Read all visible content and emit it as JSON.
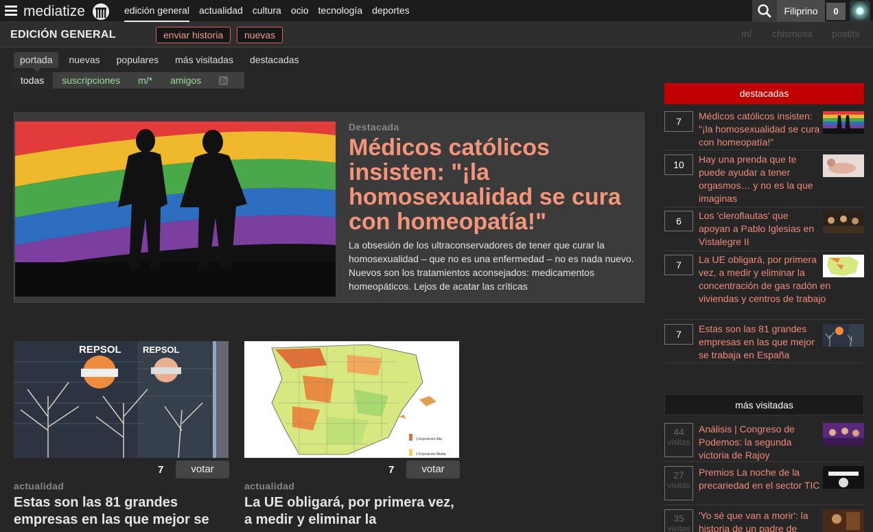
{
  "site": {
    "logo_text": "mediatize"
  },
  "main_nav": [
    {
      "label": "edición general"
    },
    {
      "label": "actualidad"
    },
    {
      "label": "cultura"
    },
    {
      "label": "ocio"
    },
    {
      "label": "tecnología"
    },
    {
      "label": "deportes"
    }
  ],
  "user": {
    "name": "Filiprino",
    "notifications": "0"
  },
  "section": {
    "title": "EDICIÓN GENERAL",
    "submit_label": "enviar historia",
    "new_label": "nuevas",
    "links": [
      "m/",
      "chismosa",
      "postits"
    ]
  },
  "tabs": [
    "portada",
    "nuevas",
    "populares",
    "más visitadas",
    "destacadas"
  ],
  "subtabs": [
    "todas",
    "suscripciones",
    "m/*",
    "amigos"
  ],
  "featured": {
    "kicker": "Destacada",
    "title": "Médicos católicos insisten: \"¡la homosexualidad se cura con homeopatía!\"",
    "summary": "La obsesión de los ultraconservadores de tener que curar la homosexualidad – que no es una enfermedad – no es nada nuevo. Nuevos son los tratamientos aconsejados: medicamentos homeopáticos. Lejos de acatar las críticas"
  },
  "cards": [
    {
      "votes": "7",
      "vote_label": "votar",
      "category": "actualidad",
      "title": "Estas son las 81 grandes empresas en las que mejor se"
    },
    {
      "votes": "7",
      "vote_label": "votar",
      "category": "actualidad",
      "title": "La UE obligará, por primera vez, a medir y eliminar la"
    }
  ],
  "sidebar": {
    "featured_heading": "destacadas",
    "featured_items": [
      {
        "count": "7",
        "title": "Médicos católicos insisten: \"¡la homosexualidad se cura con homeopatía!\""
      },
      {
        "count": "10",
        "title": "Hay una prenda que te puede ayudar a tener orgasmos… y no es la que imaginas"
      },
      {
        "count": "6",
        "title": "Los 'cleroflautas' que apoyan a Pablo Iglesias en Vistalegre II"
      },
      {
        "count": "7",
        "title": "La UE obligará, por primera vez, a medir y eliminar la concentración de gas radón en viviendas y centros de trabajo"
      },
      {
        "count": "7",
        "title": "Estas son las 81 grandes empresas en las que mejor se trabaja en España"
      }
    ],
    "visited_heading": "más visitadas",
    "visited_items": [
      {
        "count": "44",
        "unit": "visitas",
        "title": "Análisis | Congreso de Podemos: la segunda victoria de Rajoy"
      },
      {
        "count": "27",
        "unit": "visitas",
        "title": "Premios La noche de la precariedad en el sector TIC"
      },
      {
        "count": "35",
        "unit": "visitas",
        "title": "'Yo sé que van a morir': la historia de un padre de"
      }
    ]
  },
  "map_legend": {
    "high": "2  Exposición Alta",
    "medium": "1  Exposición Media"
  },
  "colors": {
    "accent": "#f2957b",
    "featured_head": "#c00000",
    "subtab_link": "#9ed89e"
  }
}
